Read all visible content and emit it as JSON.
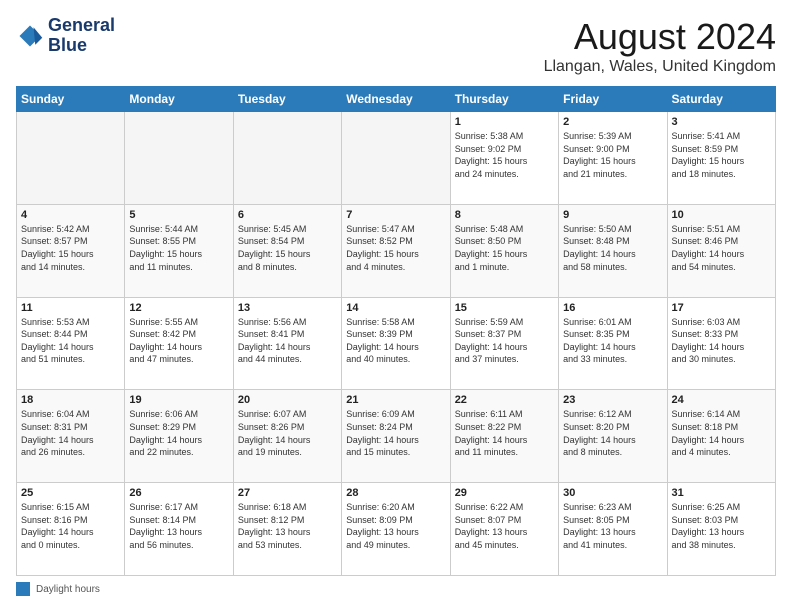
{
  "logo": {
    "line1": "General",
    "line2": "Blue"
  },
  "title": "August 2024",
  "location": "Llangan, Wales, United Kingdom",
  "days_of_week": [
    "Sunday",
    "Monday",
    "Tuesday",
    "Wednesday",
    "Thursday",
    "Friday",
    "Saturday"
  ],
  "footer_label": "Daylight hours",
  "weeks": [
    [
      {
        "day": "",
        "info": ""
      },
      {
        "day": "",
        "info": ""
      },
      {
        "day": "",
        "info": ""
      },
      {
        "day": "",
        "info": ""
      },
      {
        "day": "1",
        "info": "Sunrise: 5:38 AM\nSunset: 9:02 PM\nDaylight: 15 hours\nand 24 minutes."
      },
      {
        "day": "2",
        "info": "Sunrise: 5:39 AM\nSunset: 9:00 PM\nDaylight: 15 hours\nand 21 minutes."
      },
      {
        "day": "3",
        "info": "Sunrise: 5:41 AM\nSunset: 8:59 PM\nDaylight: 15 hours\nand 18 minutes."
      }
    ],
    [
      {
        "day": "4",
        "info": "Sunrise: 5:42 AM\nSunset: 8:57 PM\nDaylight: 15 hours\nand 14 minutes."
      },
      {
        "day": "5",
        "info": "Sunrise: 5:44 AM\nSunset: 8:55 PM\nDaylight: 15 hours\nand 11 minutes."
      },
      {
        "day": "6",
        "info": "Sunrise: 5:45 AM\nSunset: 8:54 PM\nDaylight: 15 hours\nand 8 minutes."
      },
      {
        "day": "7",
        "info": "Sunrise: 5:47 AM\nSunset: 8:52 PM\nDaylight: 15 hours\nand 4 minutes."
      },
      {
        "day": "8",
        "info": "Sunrise: 5:48 AM\nSunset: 8:50 PM\nDaylight: 15 hours\nand 1 minute."
      },
      {
        "day": "9",
        "info": "Sunrise: 5:50 AM\nSunset: 8:48 PM\nDaylight: 14 hours\nand 58 minutes."
      },
      {
        "day": "10",
        "info": "Sunrise: 5:51 AM\nSunset: 8:46 PM\nDaylight: 14 hours\nand 54 minutes."
      }
    ],
    [
      {
        "day": "11",
        "info": "Sunrise: 5:53 AM\nSunset: 8:44 PM\nDaylight: 14 hours\nand 51 minutes."
      },
      {
        "day": "12",
        "info": "Sunrise: 5:55 AM\nSunset: 8:42 PM\nDaylight: 14 hours\nand 47 minutes."
      },
      {
        "day": "13",
        "info": "Sunrise: 5:56 AM\nSunset: 8:41 PM\nDaylight: 14 hours\nand 44 minutes."
      },
      {
        "day": "14",
        "info": "Sunrise: 5:58 AM\nSunset: 8:39 PM\nDaylight: 14 hours\nand 40 minutes."
      },
      {
        "day": "15",
        "info": "Sunrise: 5:59 AM\nSunset: 8:37 PM\nDaylight: 14 hours\nand 37 minutes."
      },
      {
        "day": "16",
        "info": "Sunrise: 6:01 AM\nSunset: 8:35 PM\nDaylight: 14 hours\nand 33 minutes."
      },
      {
        "day": "17",
        "info": "Sunrise: 6:03 AM\nSunset: 8:33 PM\nDaylight: 14 hours\nand 30 minutes."
      }
    ],
    [
      {
        "day": "18",
        "info": "Sunrise: 6:04 AM\nSunset: 8:31 PM\nDaylight: 14 hours\nand 26 minutes."
      },
      {
        "day": "19",
        "info": "Sunrise: 6:06 AM\nSunset: 8:29 PM\nDaylight: 14 hours\nand 22 minutes."
      },
      {
        "day": "20",
        "info": "Sunrise: 6:07 AM\nSunset: 8:26 PM\nDaylight: 14 hours\nand 19 minutes."
      },
      {
        "day": "21",
        "info": "Sunrise: 6:09 AM\nSunset: 8:24 PM\nDaylight: 14 hours\nand 15 minutes."
      },
      {
        "day": "22",
        "info": "Sunrise: 6:11 AM\nSunset: 8:22 PM\nDaylight: 14 hours\nand 11 minutes."
      },
      {
        "day": "23",
        "info": "Sunrise: 6:12 AM\nSunset: 8:20 PM\nDaylight: 14 hours\nand 8 minutes."
      },
      {
        "day": "24",
        "info": "Sunrise: 6:14 AM\nSunset: 8:18 PM\nDaylight: 14 hours\nand 4 minutes."
      }
    ],
    [
      {
        "day": "25",
        "info": "Sunrise: 6:15 AM\nSunset: 8:16 PM\nDaylight: 14 hours\nand 0 minutes."
      },
      {
        "day": "26",
        "info": "Sunrise: 6:17 AM\nSunset: 8:14 PM\nDaylight: 13 hours\nand 56 minutes."
      },
      {
        "day": "27",
        "info": "Sunrise: 6:18 AM\nSunset: 8:12 PM\nDaylight: 13 hours\nand 53 minutes."
      },
      {
        "day": "28",
        "info": "Sunrise: 6:20 AM\nSunset: 8:09 PM\nDaylight: 13 hours\nand 49 minutes."
      },
      {
        "day": "29",
        "info": "Sunrise: 6:22 AM\nSunset: 8:07 PM\nDaylight: 13 hours\nand 45 minutes."
      },
      {
        "day": "30",
        "info": "Sunrise: 6:23 AM\nSunset: 8:05 PM\nDaylight: 13 hours\nand 41 minutes."
      },
      {
        "day": "31",
        "info": "Sunrise: 6:25 AM\nSunset: 8:03 PM\nDaylight: 13 hours\nand 38 minutes."
      }
    ]
  ]
}
